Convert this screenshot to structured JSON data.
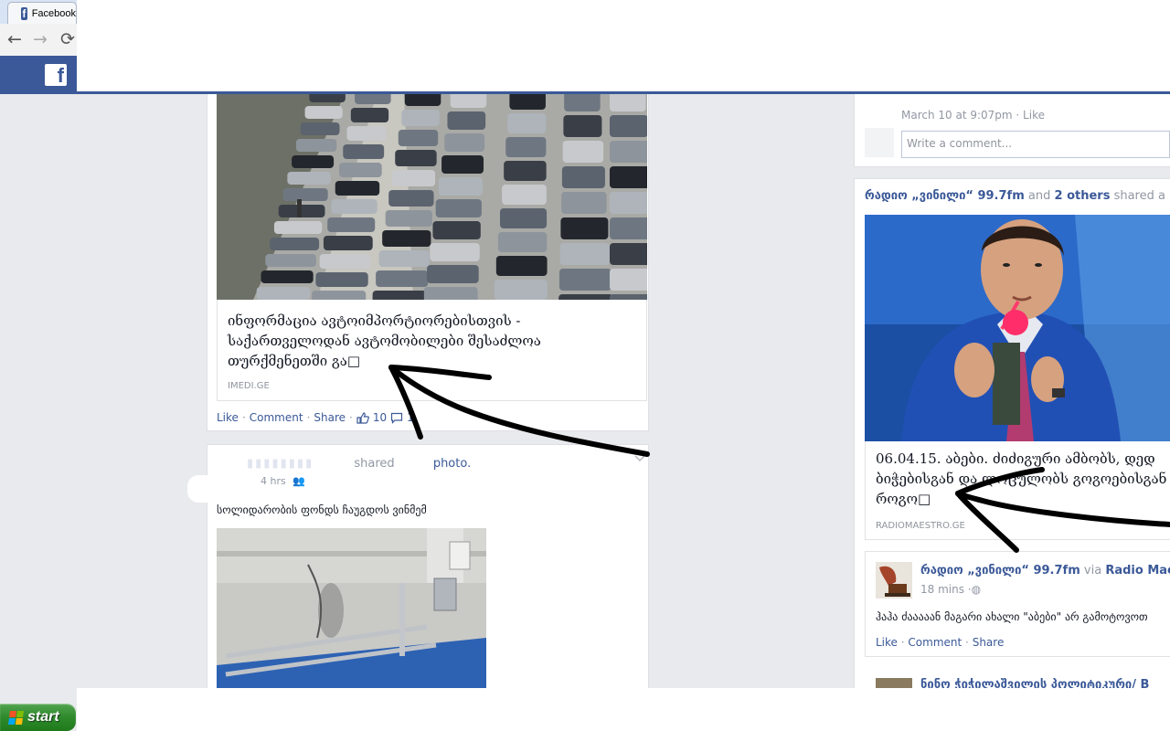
{
  "browser": {
    "tab_title": "Facebook",
    "back_glyph": "←",
    "forward_glyph": "→",
    "reload_glyph": "⟳"
  },
  "fb_logo": "f",
  "left_feed": {
    "link_post": {
      "title": "ინფორმაცია ავტოიმპორტიორებისთვის - საქართველოდან ავტომობილები შესაძლოა თურქმენეთში გა□",
      "domain": "IMEDI.GE",
      "actions": {
        "like": "Like",
        "comment": "Comment",
        "share": "Share",
        "sep": "·",
        "like_count": "10",
        "comment_count": "1"
      }
    },
    "photo_post": {
      "shared_word": "shared",
      "photo_word": "photo.",
      "time": "4 hrs",
      "text": "სოლიდარობის ფონდს ჩაუგდოს ვინმემ"
    }
  },
  "right_feed": {
    "comment": {
      "meta": "March 10 at 9:07pm · Like",
      "input_placeholder": "Write a comment..."
    },
    "share_post": {
      "page_name": "რადიო „ვინილი“ 99.7fm",
      "and_text": "and",
      "others": "2 others",
      "shared_text": "shared a lin",
      "link_title_line1": "06.04.15. აბები. ძიძიგური ამბობს, დედ",
      "link_title_line2": "ბიჭებისგან და ლოცულობს გოგოებისგან ა",
      "link_title_line3": "როგო□",
      "domain": "RADIOMAESTRO.GE"
    },
    "inner_post": {
      "page_name": "რადიო „ვინილი“ 99.7fm",
      "via": "via",
      "via_page": "Radio Mae",
      "time": "18 mins",
      "text": "ჰაჰა ძააააან მაგარი ახალი \"აბები\" არ გამოტოვოთ",
      "actions": {
        "like": "Like",
        "comment": "Comment",
        "share": "Share",
        "sep": "·"
      }
    },
    "next_post_title": "ნინო ჭიჭილაშვილის პოლიტიკური/ B"
  },
  "taskbar": {
    "start_label": "start"
  },
  "colors": {
    "fb_blue": "#3b5998",
    "link": "#3b5998",
    "muted": "#9197a3",
    "background": "#e9eaed"
  }
}
